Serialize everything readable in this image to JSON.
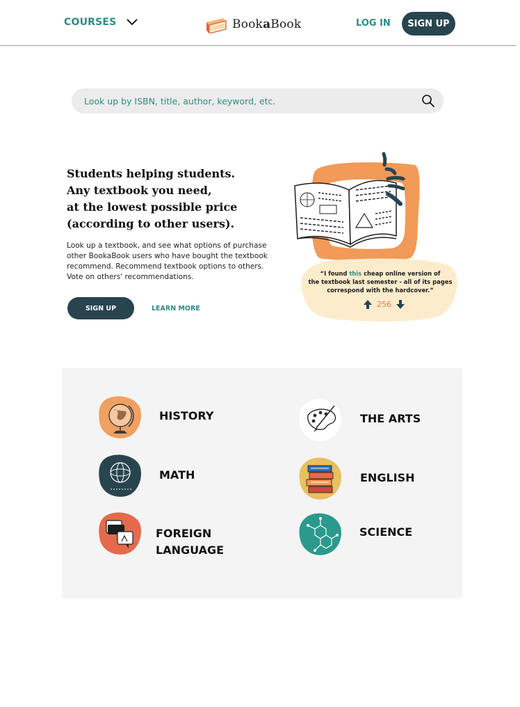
{
  "header": {
    "courses_label": "COURSES",
    "brand_prefix": "Book",
    "brand_middle": "a",
    "brand_suffix": "Book",
    "login_label": "LOG IN",
    "signup_label": "SIGN UP"
  },
  "search": {
    "placeholder": "Look up by ISBN, title, author, keyword, etc."
  },
  "hero": {
    "title_lines": [
      "Students helping students.",
      "Any textbook you need,",
      "at the lowest possible price",
      "(according to other users)."
    ],
    "description_lines": [
      "Look up a textbook, and see what options of purchase",
      "other BookaBook users who have bought the textbook",
      "recommend. Recommend textbook options to others.",
      "Vote on others' recommendations."
    ],
    "signup_label": "SIGN UP",
    "learn_more_label": "LEARN MORE"
  },
  "testimonial": {
    "line1_before": "“I found ",
    "line1_highlight": "this",
    "line1_after": " cheap online version of",
    "line2": "the textbook last semester - all of its pages",
    "line3": "correspond with the hardcover.”",
    "votes": "256"
  },
  "subjects": [
    {
      "label_lines": [
        "HISTORY"
      ],
      "icon": "globe-icon",
      "blob_color": "#f0a060"
    },
    {
      "label_lines": [
        "THE ARTS"
      ],
      "icon": "palette-icon",
      "blob_color": "#ffffff"
    },
    {
      "label_lines": [
        "MATH"
      ],
      "icon": "sphere-formula-icon",
      "blob_color": "#28444f"
    },
    {
      "label_lines": [
        "ENGLISH"
      ],
      "icon": "book-stack-icon",
      "blob_color": "#e8c060"
    },
    {
      "label_lines": [
        "FOREIGN",
        "LANGUAGE"
      ],
      "icon": "translate-icon",
      "blob_color": "#e56a4b"
    },
    {
      "label_lines": [
        "SCIENCE"
      ],
      "icon": "molecule-icon",
      "blob_color": "#2a9a8c"
    }
  ],
  "colors": {
    "teal": "#2a8c86",
    "navy": "#28444f",
    "orange": "#f29a57",
    "cream": "#fdeccc",
    "panel": "#f4f4f4"
  }
}
